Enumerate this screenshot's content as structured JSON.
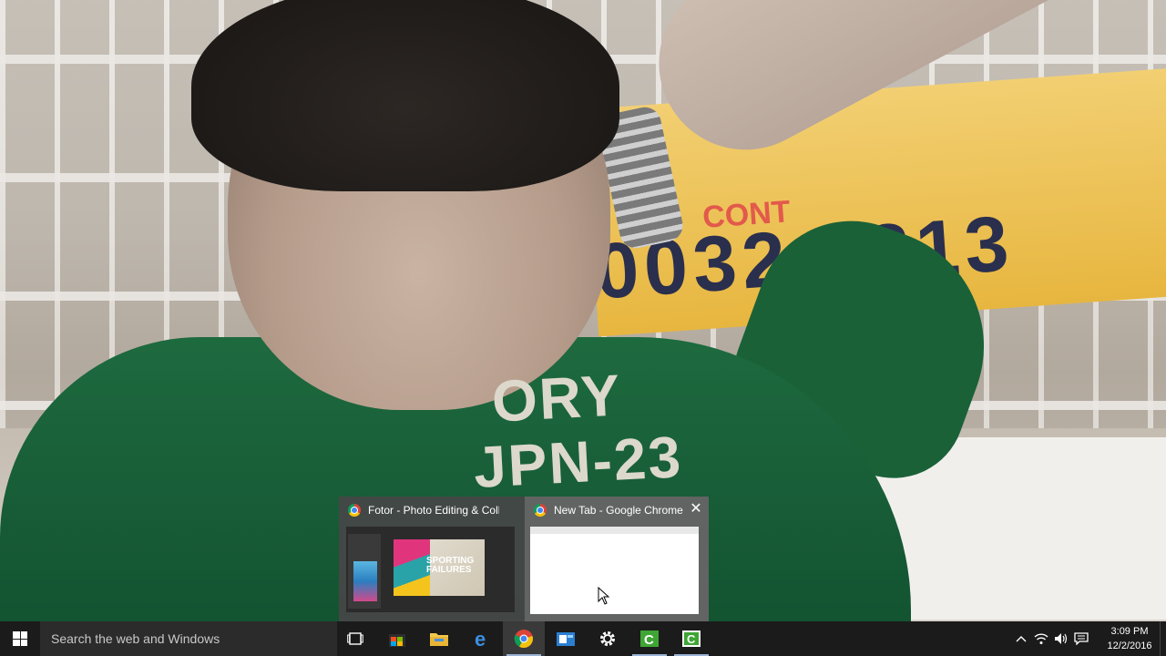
{
  "wallpaper": {
    "banner_top_text": "CONT",
    "banner_number_text": "0032  2313",
    "shirt_line_1": "ORY",
    "shirt_line_2": "JPN-23"
  },
  "preview": {
    "items": [
      {
        "title": "Fotor - Photo Editing & Collag...",
        "icon": "chrome-icon",
        "thumb_text": "SPORTING FAILURES"
      },
      {
        "title": "New Tab - Google Chrome",
        "icon": "chrome-icon"
      }
    ],
    "close_label": "✕"
  },
  "taskbar": {
    "search_placeholder": "Search the web and Windows",
    "apps": [
      {
        "name": "task-view-icon"
      },
      {
        "name": "store-icon"
      },
      {
        "name": "file-explorer-icon"
      },
      {
        "name": "edge-icon"
      },
      {
        "name": "chrome-icon"
      },
      {
        "name": "outlook-icon"
      },
      {
        "name": "settings-icon"
      },
      {
        "name": "camtasia-recorder-icon"
      },
      {
        "name": "camtasia-studio-icon"
      }
    ],
    "tray": {
      "time": "3:09 PM",
      "date": "12/2/2016"
    }
  },
  "colors": {
    "taskbar": "#1b1b1b",
    "accent": "#9ab4d6",
    "shirt": "#1e6a3f",
    "banner": "#e7b63f"
  }
}
